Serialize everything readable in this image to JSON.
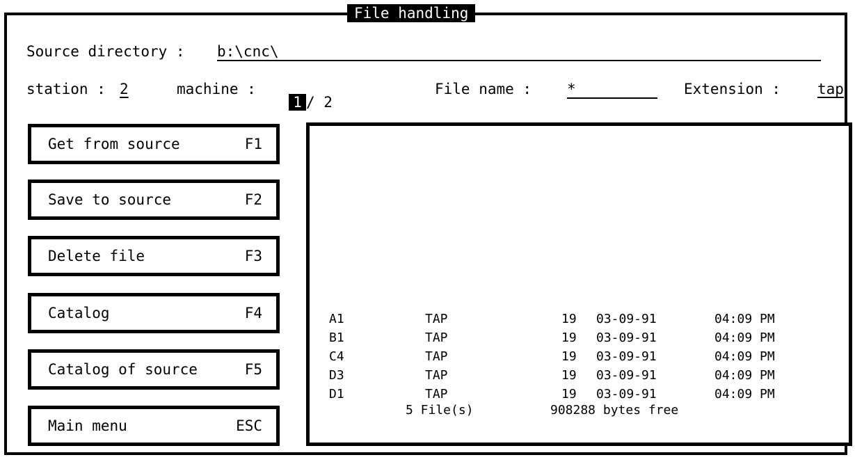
{
  "window": {
    "title": "File handling"
  },
  "source": {
    "label": "Source directory :",
    "value": "b:\\cnc\\"
  },
  "station": {
    "label": "station :",
    "value": "2"
  },
  "machine": {
    "label": "machine :",
    "current": "1",
    "separator": "/",
    "total": "2"
  },
  "filename": {
    "label": "File name :",
    "value": "*"
  },
  "extension": {
    "label": "Extension :",
    "value": "tap"
  },
  "buttons": [
    {
      "label": "Get from source",
      "key": "F1"
    },
    {
      "label": "Save to source",
      "key": "F2"
    },
    {
      "label": "Delete file",
      "key": "F3"
    },
    {
      "label": "Catalog",
      "key": "F4"
    },
    {
      "label": "Catalog of source",
      "key": "F5"
    },
    {
      "label": "Main menu",
      "key": "ESC"
    }
  ],
  "files": [
    {
      "name": "A1",
      "ext": "TAP",
      "size": "19",
      "date": "03-09-91",
      "time": "04:09 PM"
    },
    {
      "name": "B1",
      "ext": "TAP",
      "size": "19",
      "date": "03-09-91",
      "time": "04:09 PM"
    },
    {
      "name": "C4",
      "ext": "TAP",
      "size": "19",
      "date": "03-09-91",
      "time": "04:09 PM"
    },
    {
      "name": "D3",
      "ext": "TAP",
      "size": "19",
      "date": "03-09-91",
      "time": "04:09 PM"
    },
    {
      "name": "D1",
      "ext": "TAP",
      "size": "19",
      "date": "03-09-91",
      "time": "04:09 PM"
    }
  ],
  "summary": {
    "count": "5 File(s)",
    "free": "908288 bytes free"
  }
}
